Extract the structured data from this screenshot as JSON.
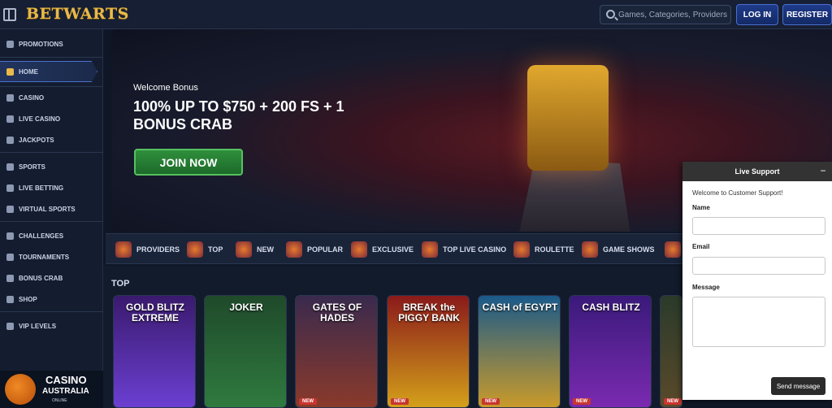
{
  "header": {
    "logo": "BETWARTS",
    "search_placeholder": "Games, Categories, Providers",
    "login_label": "LOG IN",
    "register_label": "REGISTER"
  },
  "sidebar": {
    "items": [
      {
        "label": "PROMOTIONS",
        "icon": "gift-icon"
      },
      {
        "label": "HOME",
        "icon": "home-icon",
        "active": true
      },
      {
        "label": "CASINO",
        "icon": "casino-icon"
      },
      {
        "label": "LIVE CASINO",
        "icon": "live-casino-icon"
      },
      {
        "label": "JACKPOTS",
        "icon": "jackpot-icon"
      },
      {
        "label": "SPORTS",
        "icon": "sports-icon"
      },
      {
        "label": "LIVE BETTING",
        "icon": "live-betting-icon"
      },
      {
        "label": "VIRTUAL SPORTS",
        "icon": "virtual-sports-icon"
      },
      {
        "label": "CHALLENGES",
        "icon": "challenges-icon"
      },
      {
        "label": "TOURNAMENTS",
        "icon": "trophy-icon"
      },
      {
        "label": "BONUS CRAB",
        "icon": "crab-icon"
      },
      {
        "label": "SHOP",
        "icon": "shop-icon"
      },
      {
        "label": "VIP LEVELS",
        "icon": "vip-icon"
      }
    ]
  },
  "promo_badge": {
    "line1": "CASINO",
    "line2": "AUSTRALIA",
    "line3": "ONLINE"
  },
  "hero": {
    "welcome": "Welcome Bonus",
    "headline": "100% UP TO $750 + 200 FS + 1 BONUS CRAB",
    "cta": "JOIN NOW"
  },
  "categories": [
    {
      "label": "PROVIDERS"
    },
    {
      "label": "TOP"
    },
    {
      "label": "NEW"
    },
    {
      "label": "POPULAR"
    },
    {
      "label": "EXCLUSIVE"
    },
    {
      "label": "TOP LIVE CASINO"
    },
    {
      "label": "ROULETTE"
    },
    {
      "label": "GAME SHOWS"
    }
  ],
  "games": {
    "section_title": "TOP",
    "cards": [
      {
        "title": "GOLD BLITZ EXTREME",
        "badge": "",
        "color_top": "#3a1a6e",
        "color_bottom": "#6b3fd1"
      },
      {
        "title": "JOKER",
        "badge": "",
        "color_top": "#1f4a2a",
        "color_bottom": "#2f7a3f"
      },
      {
        "title": "GATES OF HADES",
        "badge": "NEW",
        "color_top": "#3a2a4e",
        "color_bottom": "#8a3a2a"
      },
      {
        "title": "BREAK the PIGGY BANK",
        "badge": "NEW",
        "color_top": "#8a1a1a",
        "color_bottom": "#d4a01a"
      },
      {
        "title": "CASH of EGYPT",
        "badge": "NEW",
        "color_top": "#1a5a8a",
        "color_bottom": "#c99a2a"
      },
      {
        "title": "CASH BLITZ",
        "badge": "NEW",
        "color_top": "#3a1a7a",
        "color_bottom": "#7a2ab0"
      },
      {
        "title": "",
        "badge": "NEW",
        "color_top": "#2a3a2a",
        "color_bottom": "#5a4a2a"
      }
    ]
  },
  "support": {
    "title": "Live Support",
    "minimize": "−",
    "welcome": "Welcome to Customer Support!",
    "name_label": "Name",
    "email_label": "Email",
    "message_label": "Message",
    "send_label": "Send message"
  }
}
